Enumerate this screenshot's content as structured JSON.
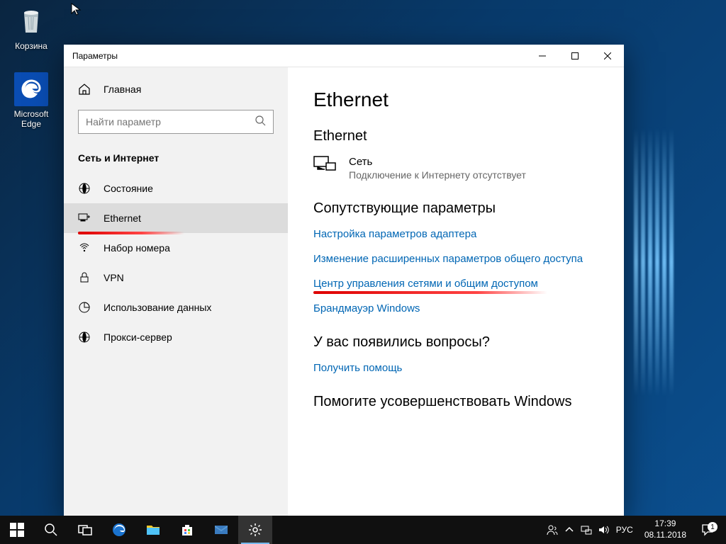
{
  "desktop": {
    "recycle_label": "Корзина",
    "edge_label": "Microsoft Edge"
  },
  "window": {
    "title": "Параметры",
    "home": "Главная",
    "search_placeholder": "Найти параметр",
    "section": "Сеть и Интернет",
    "nav": {
      "status": "Состояние",
      "ethernet": "Ethernet",
      "dialup": "Набор номера",
      "vpn": "VPN",
      "datausage": "Использование данных",
      "proxy": "Прокси-сервер"
    },
    "main": {
      "heading": "Ethernet",
      "subheading": "Ethernet",
      "net_name": "Сеть",
      "net_status": "Подключение к Интернету отсутствует",
      "related_heading": "Сопутствующие параметры",
      "link_adapter": "Настройка параметров адаптера",
      "link_sharing": "Изменение расширенных параметров общего доступа",
      "link_center": "Центр управления сетями и общим доступом",
      "link_firewall": "Брандмауэр Windows",
      "questions_heading": "У вас появились вопросы?",
      "link_help": "Получить помощь",
      "improve_heading": "Помогите усовершенствовать Windows"
    }
  },
  "taskbar": {
    "lang": "РУС",
    "time": "17:39",
    "date": "08.11.2018",
    "notif_count": "1"
  }
}
